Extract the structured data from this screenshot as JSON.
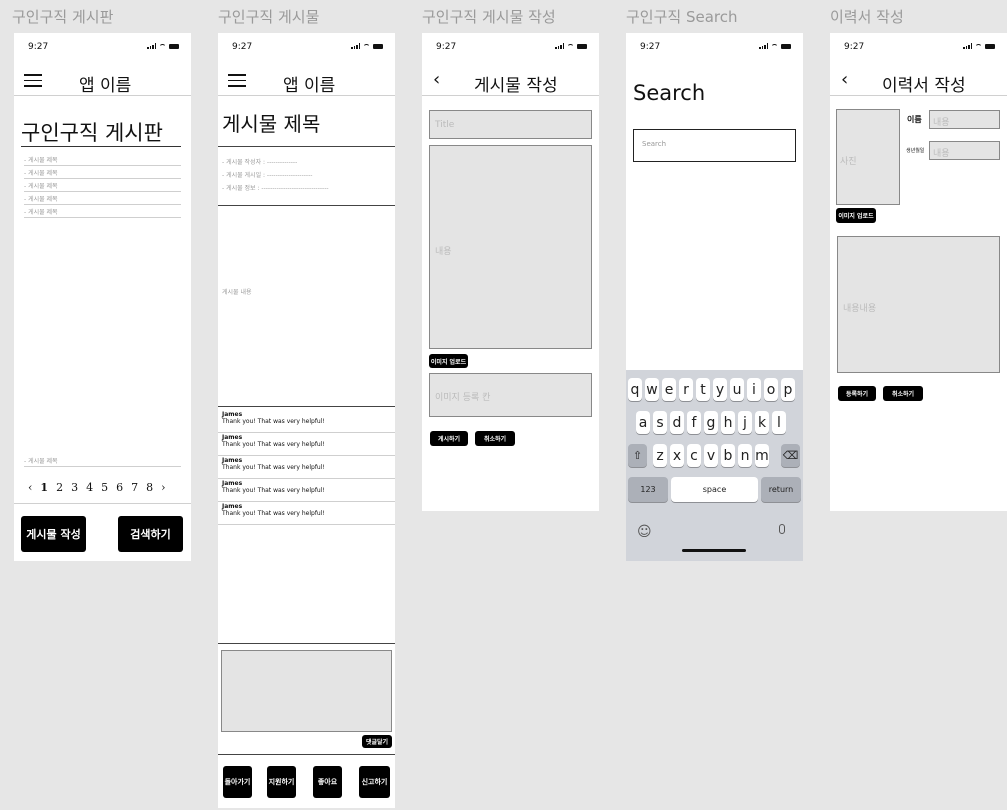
{
  "screens": {
    "board_list": {
      "caption": "구인구직 게시판",
      "time": "9:27",
      "app_name": "앱 이름",
      "heading": "구인구직 게시판",
      "posts": [
        "- 게시물 제목",
        "- 게시물 제목",
        "- 게시물 제목",
        "- 게시물 제목",
        "- 게시물 제목"
      ],
      "bottom_post": "- 게시물 제목",
      "pagination": {
        "prev": "‹",
        "pages": [
          "1",
          "2",
          "3",
          "4",
          "5",
          "6",
          "7",
          "8"
        ],
        "next": "›"
      },
      "write_label": "게시물 작성",
      "search_label": "검색하기"
    },
    "post_detail": {
      "caption": "구인구직 게시물",
      "time": "9:27",
      "app_name": "앱 이름",
      "title": "게시물 제목",
      "meta": [
        "- 게시물 작성자 : --------------",
        "- 게시물 게시일 : ---------------------",
        "- 게시물 정보 : -------------------------------"
      ],
      "content": "게시물 내용",
      "comments": [
        {
          "author": "James",
          "text": "Thank you! That was very helpful!"
        },
        {
          "author": "James",
          "text": "Thank you! That was very helpful!"
        },
        {
          "author": "James",
          "text": "Thank you! That was very helpful!"
        },
        {
          "author": "James",
          "text": "Thank you! That was very helpful!"
        },
        {
          "author": "James",
          "text": "Thank you! That was very helpful!"
        }
      ],
      "comment_submit": "댓글달기",
      "actions": [
        "돌아가기",
        "지원하기",
        "좋아요",
        "신고하기"
      ]
    },
    "post_write": {
      "caption": "구인구직 게시물 작성",
      "time": "9:27",
      "back": "‹",
      "nav_title": "게시물 작성",
      "title_placeholder": "Title",
      "content_placeholder": "내용",
      "image_upload": "이미지 업로드",
      "image_area": "이미지 등록 칸",
      "submit": "게시하기",
      "cancel": "취소하기"
    },
    "search": {
      "caption": "구인구직 Search",
      "time": "9:27",
      "heading": "Search",
      "placeholder": "Search",
      "keyboard": {
        "row1": [
          "q",
          "w",
          "e",
          "r",
          "t",
          "y",
          "u",
          "i",
          "o",
          "p"
        ],
        "row2": [
          "a",
          "s",
          "d",
          "f",
          "g",
          "h",
          "j",
          "k",
          "l"
        ],
        "row3": [
          "z",
          "x",
          "c",
          "v",
          "b",
          "n",
          "m"
        ],
        "num": "123",
        "space": "space",
        "return": "return"
      }
    },
    "resume": {
      "caption": "이력서 작성",
      "time": "9:27",
      "back": "‹",
      "nav_title": "이력서 작성",
      "photo": "사진",
      "name_label": "이름",
      "name_value": "내용",
      "birth_label": "생년월일",
      "birth_value": "내용",
      "image_upload": "이미지 업로드",
      "content": "내용내용",
      "register": "등록하기",
      "cancel": "취소하기"
    }
  }
}
